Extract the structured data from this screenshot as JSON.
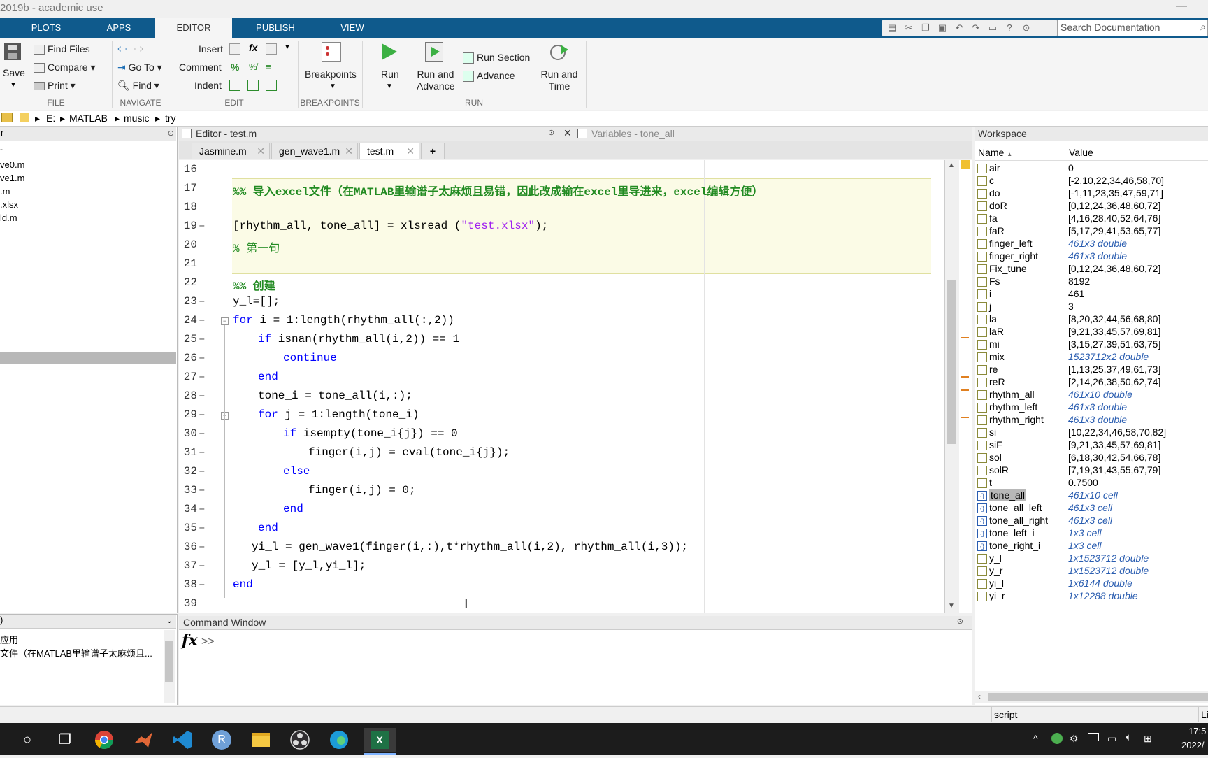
{
  "window": {
    "title": "2019b - academic use",
    "minimize": "—"
  },
  "tabs": [
    {
      "label": "PLOTS"
    },
    {
      "label": "APPS"
    },
    {
      "label": "EDITOR"
    },
    {
      "label": "PUBLISH"
    },
    {
      "label": "VIEW"
    }
  ],
  "search": {
    "placeholder": "Search Documentation"
  },
  "ribbon": {
    "file": {
      "save": "Save",
      "find_files": "Find Files",
      "compare": "Compare",
      "print": "Print",
      "group": "FILE"
    },
    "navigate": {
      "go_to": "Go To",
      "find": "Find",
      "group": "NAVIGATE"
    },
    "edit": {
      "insert": "Insert",
      "comment": "Comment",
      "indent": "Indent",
      "fx": "fx",
      "pct": "%",
      "group": "EDIT"
    },
    "breakpoints": {
      "label": "Breakpoints",
      "group": "BREAKPOINTS"
    },
    "run": {
      "run": "Run",
      "run_and": "Run and",
      "advance_word": "Advance",
      "run_section": "Run Section",
      "advance": "Advance",
      "run_time": "Run and",
      "time_word": "Time",
      "group": "RUN"
    }
  },
  "path": {
    "drive": "E:",
    "folder1": "MATLAB",
    "folder2": "music",
    "folder3": "try"
  },
  "left_pane": {
    "header": "r",
    "files": [
      "ve0.m",
      "ve1.m",
      ".m",
      ".xlsx",
      "ld.m"
    ],
    "lower_header": ")",
    "lower_lines": [
      "应用",
      "文件（在MATLAB里输谱子太麻烦且..."
    ]
  },
  "editor": {
    "header": "Editor - test.m",
    "variables_header": "Variables - tone_all",
    "file_tabs": [
      "Jasmine.m",
      "gen_wave1.m",
      "test.m"
    ],
    "close_glyph": "✕",
    "add_tab": "+",
    "line_numbers": [
      "16",
      "17",
      "18",
      "19",
      "20",
      "21",
      "22",
      "23",
      "24",
      "25",
      "26",
      "27",
      "28",
      "29",
      "30",
      "31",
      "32",
      "33",
      "34",
      "35",
      "36",
      "37",
      "38",
      "39"
    ],
    "lines": {
      "l17": "%% 导入excel文件（在MATLAB里输谱子太麻烦且易错，因此改成输在excel里导进来，excel编辑方便）",
      "l19a": "[rhythm_all, tone_all] = xlsread (",
      "l19b": "\"test.xlsx\"",
      "l19c": ");",
      "l20": "% 第一句",
      "l22": "%% 创建",
      "l23": "y_l=[];",
      "l24a": "for",
      "l24b": " i = 1:length(rhythm_all(:,2))",
      "l25a": "if",
      "l25b": " isnan(rhythm_all(i,2)) == 1",
      "l26": "continue",
      "l27": "end",
      "l28": "tone_i = tone_all(i,:);",
      "l29a": "for",
      "l29b": " j = 1:length(tone_i)",
      "l30a": "if",
      "l30b": " isempty(tone_i{j}) == 0",
      "l31": "finger(i,j) = eval(tone_i{j});",
      "l32": "else",
      "l33": "finger(i,j) = 0;",
      "l34": "end",
      "l35": "end",
      "l36": "yi_l = gen_wave1(finger(i,:),t*rhythm_all(i,2), rhythm_all(i,3));",
      "l37": "y_l = [y_l,yi_l];",
      "l38": "end"
    }
  },
  "command_window": {
    "header": "Command Window",
    "fx": "fx",
    "prompt": ">>"
  },
  "workspace": {
    "header": "Workspace",
    "col_name": "Name",
    "col_value": "Value",
    "rows": [
      {
        "name": "air",
        "value": "0",
        "italic": false
      },
      {
        "name": "c",
        "value": "[-2,10,22,34,46,58,70]",
        "italic": false
      },
      {
        "name": "do",
        "value": "[-1,11,23,35,47,59,71]",
        "italic": false
      },
      {
        "name": "doR",
        "value": "[0,12,24,36,48,60,72]",
        "italic": false
      },
      {
        "name": "fa",
        "value": "[4,16,28,40,52,64,76]",
        "italic": false
      },
      {
        "name": "faR",
        "value": "[5,17,29,41,53,65,77]",
        "italic": false
      },
      {
        "name": "finger_left",
        "value": "461x3 double",
        "italic": true
      },
      {
        "name": "finger_right",
        "value": "461x3 double",
        "italic": true
      },
      {
        "name": "Fix_tune",
        "value": "[0,12,24,36,48,60,72]",
        "italic": false
      },
      {
        "name": "Fs",
        "value": "8192",
        "italic": false
      },
      {
        "name": "i",
        "value": "461",
        "italic": false
      },
      {
        "name": "j",
        "value": "3",
        "italic": false
      },
      {
        "name": "la",
        "value": "[8,20,32,44,56,68,80]",
        "italic": false
      },
      {
        "name": "laR",
        "value": "[9,21,33,45,57,69,81]",
        "italic": false
      },
      {
        "name": "mi",
        "value": "[3,15,27,39,51,63,75]",
        "italic": false
      },
      {
        "name": "mix",
        "value": "1523712x2 double",
        "italic": true
      },
      {
        "name": "re",
        "value": "[1,13,25,37,49,61,73]",
        "italic": false
      },
      {
        "name": "reR",
        "value": "[2,14,26,38,50,62,74]",
        "italic": false
      },
      {
        "name": "rhythm_all",
        "value": "461x10 double",
        "italic": true
      },
      {
        "name": "rhythm_left",
        "value": "461x3 double",
        "italic": true
      },
      {
        "name": "rhythm_right",
        "value": "461x3 double",
        "italic": true
      },
      {
        "name": "si",
        "value": "[10,22,34,46,58,70,82]",
        "italic": false
      },
      {
        "name": "siF",
        "value": "[9,21,33,45,57,69,81]",
        "italic": false
      },
      {
        "name": "sol",
        "value": "[6,18,30,42,54,66,78]",
        "italic": false
      },
      {
        "name": "solR",
        "value": "[7,19,31,43,55,67,79]",
        "italic": false
      },
      {
        "name": "t",
        "value": "0.7500",
        "italic": false
      },
      {
        "name": "tone_all",
        "value": "461x10 cell",
        "italic": true,
        "cell": true,
        "selected": true
      },
      {
        "name": "tone_all_left",
        "value": "461x3 cell",
        "italic": true,
        "cell": true
      },
      {
        "name": "tone_all_right",
        "value": "461x3 cell",
        "italic": true,
        "cell": true
      },
      {
        "name": "tone_left_i",
        "value": "1x3 cell",
        "italic": true,
        "cell": true
      },
      {
        "name": "tone_right_i",
        "value": "1x3 cell",
        "italic": true,
        "cell": true
      },
      {
        "name": "y_l",
        "value": "1x1523712 double",
        "italic": true
      },
      {
        "name": "y_r",
        "value": "1x1523712 double",
        "italic": true
      },
      {
        "name": "yi_l",
        "value": "1x6144 double",
        "italic": true
      },
      {
        "name": "yi_r",
        "value": "1x12288 double",
        "italic": true
      }
    ]
  },
  "status": {
    "text": "script",
    "right": "Li"
  },
  "taskbar": {
    "time": "17:5",
    "date": "2022/"
  },
  "colors": {
    "tabstrip": "#0f5a8c",
    "keyword": "#0000ff",
    "comment": "#228b22",
    "string": "#a020f0",
    "cell_bg": "#fbfbe6"
  }
}
